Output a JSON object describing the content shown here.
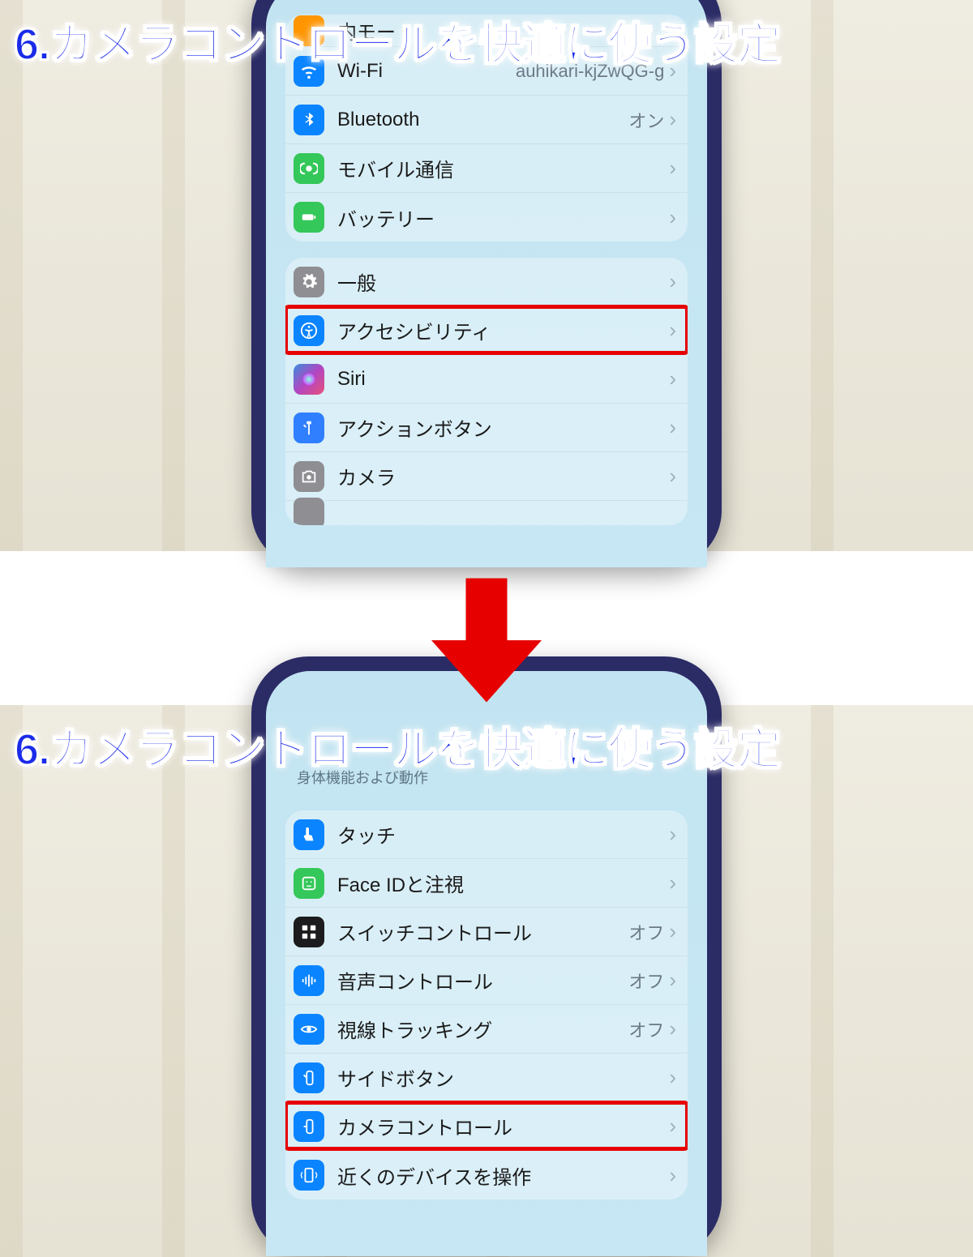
{
  "overlay_title": "6.カメラコントロールを快適に使う設定",
  "top": {
    "group1": [
      {
        "icon": "appstore",
        "label": "内モー",
        "value": "",
        "color": "c-orange"
      },
      {
        "icon": "wifi",
        "label": "Wi-Fi",
        "value": "auhikari-kjZwQG-g",
        "color": "c-blue"
      },
      {
        "icon": "bluetooth",
        "label": "Bluetooth",
        "value": "オン",
        "color": "c-blue"
      },
      {
        "icon": "antenna",
        "label": "モバイル通信",
        "value": "",
        "color": "c-green"
      },
      {
        "icon": "battery",
        "label": "バッテリー",
        "value": "",
        "color": "c-green"
      }
    ],
    "group2": [
      {
        "icon": "gear",
        "label": "一般",
        "value": "",
        "color": "c-gray"
      },
      {
        "icon": "accessibility",
        "label": "アクセシビリティ",
        "value": "",
        "color": "c-blue",
        "highlight": true
      },
      {
        "icon": "siri",
        "label": "Siri",
        "value": "",
        "color": "c-siri"
      },
      {
        "icon": "action",
        "label": "アクションボタン",
        "value": "",
        "color": "c-blue2"
      },
      {
        "icon": "camera",
        "label": "カメラ",
        "value": "",
        "color": "c-gray"
      }
    ]
  },
  "bottom": {
    "section_header": "身体機能および動作",
    "group": [
      {
        "icon": "touch",
        "label": "タッチ",
        "value": "",
        "color": "c-blue"
      },
      {
        "icon": "faceid",
        "label": "Face IDと注視",
        "value": "",
        "color": "c-green"
      },
      {
        "icon": "switch",
        "label": "スイッチコントロール",
        "value": "オフ",
        "color": "c-dark"
      },
      {
        "icon": "voice",
        "label": "音声コントロール",
        "value": "オフ",
        "color": "c-blue"
      },
      {
        "icon": "eyetrack",
        "label": "視線トラッキング",
        "value": "オフ",
        "color": "c-blue"
      },
      {
        "icon": "sidebtn",
        "label": "サイドボタン",
        "value": "",
        "color": "c-blue"
      },
      {
        "icon": "camctrl",
        "label": "カメラコントロール",
        "value": "",
        "color": "c-blue",
        "highlight": true
      },
      {
        "icon": "nearby",
        "label": "近くのデバイスを操作",
        "value": "",
        "color": "c-blue"
      }
    ]
  }
}
